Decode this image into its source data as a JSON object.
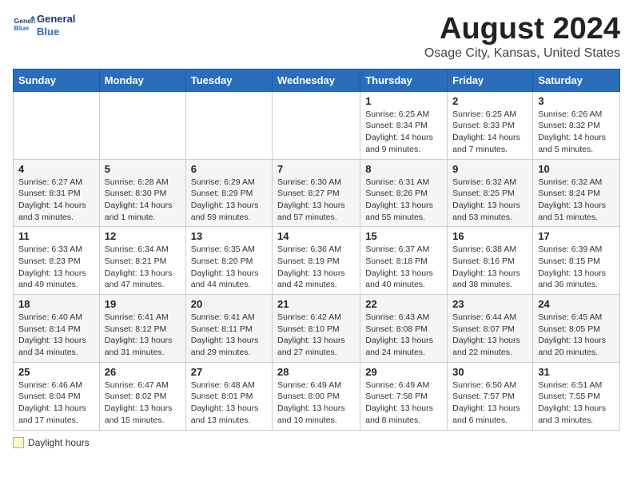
{
  "header": {
    "logo_line1": "General",
    "logo_line2": "Blue",
    "title": "August 2024",
    "subtitle": "Osage City, Kansas, United States"
  },
  "columns": [
    "Sunday",
    "Monday",
    "Tuesday",
    "Wednesday",
    "Thursday",
    "Friday",
    "Saturday"
  ],
  "weeks": [
    [
      {
        "day": "",
        "info": ""
      },
      {
        "day": "",
        "info": ""
      },
      {
        "day": "",
        "info": ""
      },
      {
        "day": "",
        "info": ""
      },
      {
        "day": "1",
        "info": "Sunrise: 6:25 AM\nSunset: 8:34 PM\nDaylight: 14 hours and 9 minutes."
      },
      {
        "day": "2",
        "info": "Sunrise: 6:25 AM\nSunset: 8:33 PM\nDaylight: 14 hours and 7 minutes."
      },
      {
        "day": "3",
        "info": "Sunrise: 6:26 AM\nSunset: 8:32 PM\nDaylight: 14 hours and 5 minutes."
      }
    ],
    [
      {
        "day": "4",
        "info": "Sunrise: 6:27 AM\nSunset: 8:31 PM\nDaylight: 14 hours and 3 minutes."
      },
      {
        "day": "5",
        "info": "Sunrise: 6:28 AM\nSunset: 8:30 PM\nDaylight: 14 hours and 1 minute."
      },
      {
        "day": "6",
        "info": "Sunrise: 6:29 AM\nSunset: 8:29 PM\nDaylight: 13 hours and 59 minutes."
      },
      {
        "day": "7",
        "info": "Sunrise: 6:30 AM\nSunset: 8:27 PM\nDaylight: 13 hours and 57 minutes."
      },
      {
        "day": "8",
        "info": "Sunrise: 6:31 AM\nSunset: 8:26 PM\nDaylight: 13 hours and 55 minutes."
      },
      {
        "day": "9",
        "info": "Sunrise: 6:32 AM\nSunset: 8:25 PM\nDaylight: 13 hours and 53 minutes."
      },
      {
        "day": "10",
        "info": "Sunrise: 6:32 AM\nSunset: 8:24 PM\nDaylight: 13 hours and 51 minutes."
      }
    ],
    [
      {
        "day": "11",
        "info": "Sunrise: 6:33 AM\nSunset: 8:23 PM\nDaylight: 13 hours and 49 minutes."
      },
      {
        "day": "12",
        "info": "Sunrise: 6:34 AM\nSunset: 8:21 PM\nDaylight: 13 hours and 47 minutes."
      },
      {
        "day": "13",
        "info": "Sunrise: 6:35 AM\nSunset: 8:20 PM\nDaylight: 13 hours and 44 minutes."
      },
      {
        "day": "14",
        "info": "Sunrise: 6:36 AM\nSunset: 8:19 PM\nDaylight: 13 hours and 42 minutes."
      },
      {
        "day": "15",
        "info": "Sunrise: 6:37 AM\nSunset: 8:18 PM\nDaylight: 13 hours and 40 minutes."
      },
      {
        "day": "16",
        "info": "Sunrise: 6:38 AM\nSunset: 8:16 PM\nDaylight: 13 hours and 38 minutes."
      },
      {
        "day": "17",
        "info": "Sunrise: 6:39 AM\nSunset: 8:15 PM\nDaylight: 13 hours and 36 minutes."
      }
    ],
    [
      {
        "day": "18",
        "info": "Sunrise: 6:40 AM\nSunset: 8:14 PM\nDaylight: 13 hours and 34 minutes."
      },
      {
        "day": "19",
        "info": "Sunrise: 6:41 AM\nSunset: 8:12 PM\nDaylight: 13 hours and 31 minutes."
      },
      {
        "day": "20",
        "info": "Sunrise: 6:41 AM\nSunset: 8:11 PM\nDaylight: 13 hours and 29 minutes."
      },
      {
        "day": "21",
        "info": "Sunrise: 6:42 AM\nSunset: 8:10 PM\nDaylight: 13 hours and 27 minutes."
      },
      {
        "day": "22",
        "info": "Sunrise: 6:43 AM\nSunset: 8:08 PM\nDaylight: 13 hours and 24 minutes."
      },
      {
        "day": "23",
        "info": "Sunrise: 6:44 AM\nSunset: 8:07 PM\nDaylight: 13 hours and 22 minutes."
      },
      {
        "day": "24",
        "info": "Sunrise: 6:45 AM\nSunset: 8:05 PM\nDaylight: 13 hours and 20 minutes."
      }
    ],
    [
      {
        "day": "25",
        "info": "Sunrise: 6:46 AM\nSunset: 8:04 PM\nDaylight: 13 hours and 17 minutes."
      },
      {
        "day": "26",
        "info": "Sunrise: 6:47 AM\nSunset: 8:02 PM\nDaylight: 13 hours and 15 minutes."
      },
      {
        "day": "27",
        "info": "Sunrise: 6:48 AM\nSunset: 8:01 PM\nDaylight: 13 hours and 13 minutes."
      },
      {
        "day": "28",
        "info": "Sunrise: 6:49 AM\nSunset: 8:00 PM\nDaylight: 13 hours and 10 minutes."
      },
      {
        "day": "29",
        "info": "Sunrise: 6:49 AM\nSunset: 7:58 PM\nDaylight: 13 hours and 8 minutes."
      },
      {
        "day": "30",
        "info": "Sunrise: 6:50 AM\nSunset: 7:57 PM\nDaylight: 13 hours and 6 minutes."
      },
      {
        "day": "31",
        "info": "Sunrise: 6:51 AM\nSunset: 7:55 PM\nDaylight: 13 hours and 3 minutes."
      }
    ]
  ],
  "legend": {
    "daylight_label": "Daylight hours"
  }
}
